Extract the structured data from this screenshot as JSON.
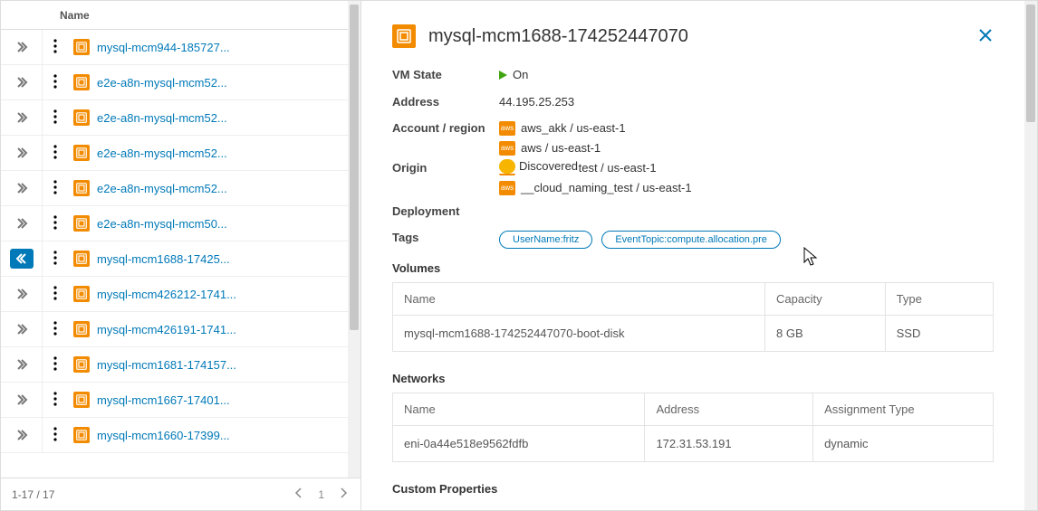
{
  "list": {
    "header": "Name",
    "items": [
      {
        "label": "mysql-mcm944-185727...",
        "expanded": false
      },
      {
        "label": "e2e-a8n-mysql-mcm52...",
        "expanded": false
      },
      {
        "label": "e2e-a8n-mysql-mcm52...",
        "expanded": false
      },
      {
        "label": "e2e-a8n-mysql-mcm52...",
        "expanded": false
      },
      {
        "label": "e2e-a8n-mysql-mcm52...",
        "expanded": false
      },
      {
        "label": "e2e-a8n-mysql-mcm50...",
        "expanded": false
      },
      {
        "label": "mysql-mcm1688-17425...",
        "expanded": true
      },
      {
        "label": "mysql-mcm426212-1741...",
        "expanded": false
      },
      {
        "label": "mysql-mcm426191-1741...",
        "expanded": false
      },
      {
        "label": "mysql-mcm1681-174157...",
        "expanded": false
      },
      {
        "label": "mysql-mcm1667-17401...",
        "expanded": false
      },
      {
        "label": "mysql-mcm1660-17399...",
        "expanded": false
      }
    ],
    "footer": {
      "range": "1-17 / 17",
      "page": "1"
    }
  },
  "detail": {
    "title": "mysql-mcm1688-174252447070",
    "labels": {
      "vm_state": "VM State",
      "address": "Address",
      "account_region": "Account / region",
      "origin": "Origin",
      "deployment": "Deployment",
      "tags": "Tags",
      "volumes": "Volumes",
      "networks": "Networks",
      "custom_properties": "Custom Properties"
    },
    "state": {
      "text": "On"
    },
    "address": "44.195.25.253",
    "accounts": [
      "aws_akk / us-east-1",
      "aws / us-east-1",
      "adelcheva-test / us-east-1",
      "__cloud_naming_test / us-east-1"
    ],
    "origin_badge": "Discovered",
    "tags": [
      "UserName:fritz",
      "EventTopic:compute.allocation.pre"
    ],
    "volumes": {
      "cols": {
        "name": "Name",
        "capacity": "Capacity",
        "type": "Type"
      },
      "rows": [
        {
          "name": "mysql-mcm1688-174252447070-boot-disk",
          "capacity": "8 GB",
          "type": "SSD"
        }
      ]
    },
    "networks": {
      "cols": {
        "name": "Name",
        "address": "Address",
        "assign": "Assignment Type"
      },
      "rows": [
        {
          "name": "eni-0a44e518e9562fdfb",
          "address": "172.31.53.191",
          "assign": "dynamic"
        }
      ]
    }
  }
}
